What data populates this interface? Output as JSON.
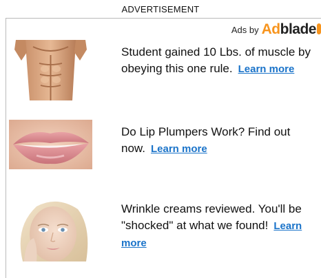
{
  "header": {
    "label": "ADVERTISEMENT"
  },
  "attribution": {
    "label": "Ads by",
    "brand_part1": "Ad",
    "brand_part2": "blade",
    "brand_color": "#f7941d"
  },
  "ads": [
    {
      "text": "Student gained 10 Lbs. of muscle by obeying this one rule.",
      "link": "Learn more",
      "image": "muscle-torso-photo"
    },
    {
      "text": "Do Lip Plumpers Work? Find out now.",
      "link": "Learn more",
      "image": "lips-photo"
    },
    {
      "text": "Wrinkle creams reviewed. You'll be \"shocked\" at what we found!",
      "link": "Learn more",
      "image": "woman-face-photo"
    }
  ],
  "colors": {
    "link": "#1a73c9",
    "frame": "#b9b9b9"
  }
}
